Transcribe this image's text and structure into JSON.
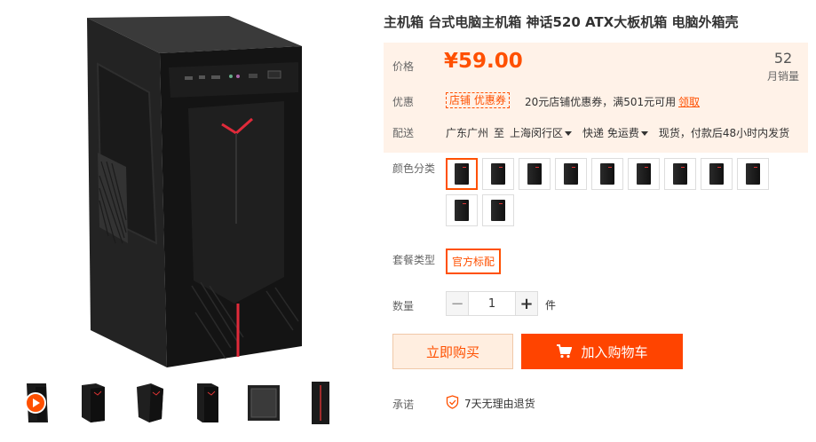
{
  "product": {
    "title": "主机箱 台式电脑主机箱 神话520 ATX大板机箱 电脑外箱壳"
  },
  "price": {
    "label": "价格",
    "value": "¥59.00",
    "sales_count": "52",
    "sales_label": "月销量"
  },
  "promo": {
    "label": "优惠",
    "tag": "店铺 优惠券",
    "text": "20元店铺优惠券，满501元可用",
    "action": "领取"
  },
  "shipping": {
    "label": "配送",
    "from": "广东广州",
    "to_word": "至",
    "dest": "上海闵行区",
    "method": "快递 免运费",
    "note": "现货，付款后48小时内发货"
  },
  "color": {
    "label": "颜色分类",
    "swatch_count": 11,
    "selected_index": 0
  },
  "package": {
    "label": "套餐类型",
    "option": "官方标配"
  },
  "quantity": {
    "label": "数量",
    "value": "1",
    "minus": "−",
    "plus": "+",
    "unit": "件"
  },
  "actions": {
    "buy_now": "立即购买",
    "add_to_cart": "加入购物车"
  },
  "promise": {
    "label": "承诺",
    "text": "7天无理由退货"
  },
  "colors": {
    "accent": "#ff5000",
    "price_bg": "#fff2e8",
    "cart_btn": "#ff4400"
  }
}
